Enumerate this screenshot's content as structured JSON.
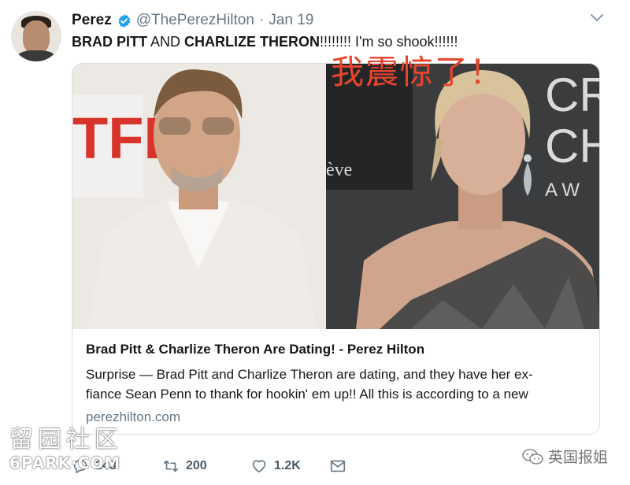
{
  "tweet": {
    "display_name": "Perez",
    "handle": "@ThePerezHilton",
    "separator": "·",
    "date": "Jan 19",
    "text_bold_1": "BRAD PITT",
    "text_mid": " AND ",
    "text_bold_2": "CHARLIZE THERON",
    "text_end": "!!!!!!!! I'm so shook!!!!!!"
  },
  "card": {
    "title": "Brad Pitt & Charlize Theron Are Dating! - Perez Hilton",
    "description_line_1": "Surprise — Brad Pitt and Charlize Theron are dating, and they have her ex-",
    "description_line_2": "fiance Sean Penn to thank for hookin' em up!! All this is according to a new",
    "domain": "perezhilton.com",
    "image_left_backdrop_text": "TFL",
    "image_right_backdrop_text_1": "CR",
    "image_right_backdrop_text_2": "CH",
    "image_right_backdrop_text_3": "A W",
    "image_right_backdrop_text_4": "ève"
  },
  "overlay": {
    "text": "我震惊了！"
  },
  "actions": {
    "reply_count": "243",
    "retweet_count": "200",
    "like_count": "1.2K"
  },
  "watermarks": {
    "left_line_1": "留园社区",
    "left_line_2": "6PARK·COM",
    "right_text": "英国报姐"
  },
  "colors": {
    "verified_blue": "#1da1f2",
    "overlay_red": "#e8452c",
    "secondary_gray": "#657786"
  },
  "icons": [
    "verified-badge-icon",
    "chevron-down-icon",
    "reply-icon",
    "retweet-icon",
    "like-icon",
    "share-icon",
    "wechat-icon"
  ]
}
